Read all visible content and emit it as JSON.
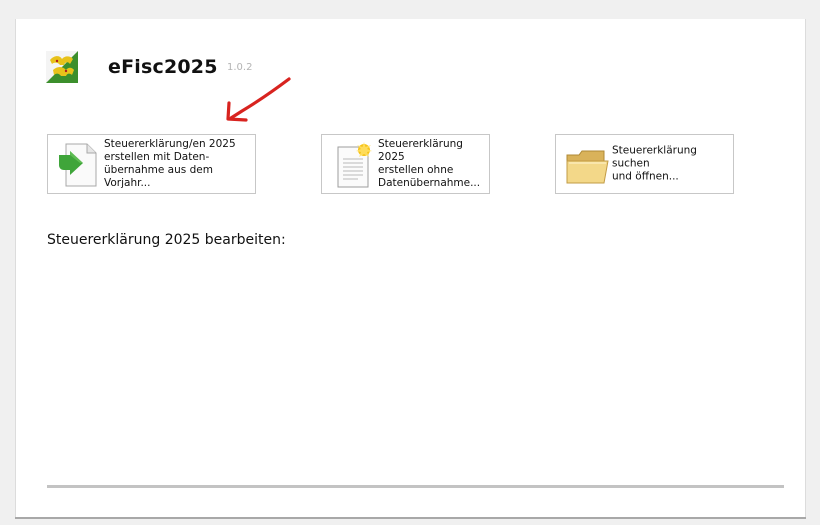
{
  "app": {
    "title": "eFisc2025",
    "version": "1.0.2"
  },
  "actions": [
    {
      "label": "Steuererklärung/en 2025\nerstellen mit Daten-\nübernahme aus dem Vorjahr...",
      "icon": "document-import-green-arrow-icon"
    },
    {
      "label": "Steuererklärung 2025\nerstellen ohne\nDatenübernahme...",
      "icon": "new-document-icon"
    },
    {
      "label": "Steuererklärung suchen\nund öffnen...",
      "icon": "open-folder-icon"
    }
  ],
  "section": {
    "heading": "Steuererklärung 2025 bearbeiten:"
  },
  "colors": {
    "annotation_arrow": "#d8231f",
    "import_arrow": "#3fa53a",
    "logo_green": "#3c8f2c",
    "logo_gold": "#e8c21a"
  }
}
